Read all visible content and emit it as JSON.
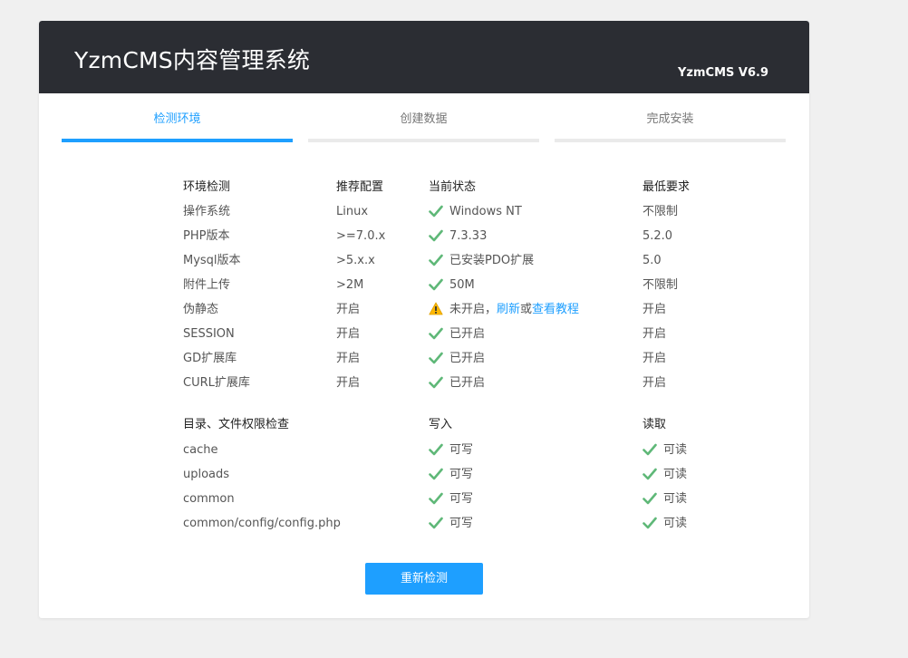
{
  "header": {
    "title": "YzmCMS内容管理系统",
    "version": "YzmCMS V6.9"
  },
  "steps": [
    {
      "label": "检测环境",
      "active": true
    },
    {
      "label": "创建数据",
      "active": false
    },
    {
      "label": "完成安装",
      "active": false
    }
  ],
  "env": {
    "headers": {
      "item": "环境检测",
      "recommended": "推荐配置",
      "current": "当前状态",
      "minimum": "最低要求"
    },
    "rows": [
      {
        "item": "操作系统",
        "recommended": "Linux",
        "current": "Windows NT",
        "minimum": "不限制"
      },
      {
        "item": "PHP版本",
        "recommended": ">=7.0.x",
        "current": "7.3.33",
        "minimum": "5.2.0"
      },
      {
        "item": "Mysql版本",
        "recommended": ">5.x.x",
        "current": "已安装PDO扩展",
        "minimum": "5.0"
      },
      {
        "item": "附件上传",
        "recommended": ">2M",
        "current": "50M",
        "minimum": "不限制"
      },
      {
        "item": "伪静态",
        "recommended": "开启",
        "current": "未开启，",
        "current_link1": "刷新",
        "current_or": "或",
        "current_link2": "查看教程",
        "minimum": "开启"
      },
      {
        "item": "SESSION",
        "recommended": "开启",
        "current": "已开启",
        "minimum": "开启"
      },
      {
        "item": "GD扩展库",
        "recommended": "开启",
        "current": "已开启",
        "minimum": "开启"
      },
      {
        "item": "CURL扩展库",
        "recommended": "开启",
        "current": "已开启",
        "minimum": "开启"
      }
    ]
  },
  "perms": {
    "headers": {
      "path": "目录、文件权限检查",
      "write": "写入",
      "read": "读取"
    },
    "rows": [
      {
        "path": "cache",
        "write": "可写",
        "read": "可读"
      },
      {
        "path": "uploads",
        "write": "可写",
        "read": "可读"
      },
      {
        "path": "common",
        "write": "可写",
        "read": "可读"
      },
      {
        "path": "common/config/config.php",
        "write": "可写",
        "read": "可读"
      }
    ]
  },
  "button": {
    "label": "重新检测"
  },
  "colors": {
    "accent": "#1e9fff",
    "ok": "#5fb878",
    "warn": "#ffb800",
    "header_bg": "#2b2d33"
  },
  "icons": {
    "ok": "check-icon",
    "warn": "warning-icon"
  }
}
